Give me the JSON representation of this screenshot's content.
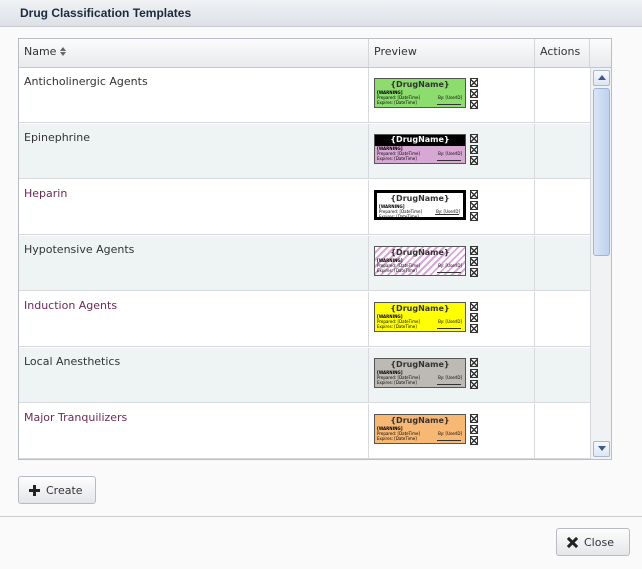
{
  "dialog": {
    "title": "Drug Classification Templates"
  },
  "grid": {
    "columns": {
      "name": "Name",
      "preview": "Preview",
      "actions": "Actions"
    },
    "rows": [
      {
        "name": "Anticholinergic Agents",
        "name_color": "#333333",
        "label_bg": "#8cdc6e",
        "label_pattern": "solid",
        "band": false,
        "border": "thin"
      },
      {
        "name": "Epinephrine",
        "name_color": "#333333",
        "label_bg": "#d8a8d4",
        "label_pattern": "solid",
        "band": true,
        "border": "thin"
      },
      {
        "name": "Heparin",
        "name_color": "#6b2a5a",
        "label_bg": "#ffffff",
        "label_pattern": "solid",
        "band": false,
        "border": "thick"
      },
      {
        "name": "Hypotensive Agents",
        "name_color": "#333333",
        "label_bg": "#ffffff",
        "label_pattern": "striped",
        "band": false,
        "border": "thin"
      },
      {
        "name": "Induction Agents",
        "name_color": "#6b2a5a",
        "label_bg": "#ffff00",
        "label_pattern": "solid",
        "band": false,
        "border": "thin"
      },
      {
        "name": "Local Anesthetics",
        "name_color": "#333333",
        "label_bg": "#bdbab3",
        "label_pattern": "solid",
        "band": false,
        "border": "thin"
      },
      {
        "name": "Major Tranquilizers",
        "name_color": "#6b2a5a",
        "label_bg": "#f7b873",
        "label_pattern": "solid",
        "band": false,
        "border": "thin"
      }
    ]
  },
  "label_template": {
    "drug_name": "{DrugName}",
    "warning": "[WARNING]",
    "prepared_by": "Prepared: [DateTime]",
    "expires": "Expires: [DateTime]",
    "user": "By: [UserID]"
  },
  "buttons": {
    "create": "Create",
    "close": "Close"
  },
  "icons": {
    "create": "plus-icon",
    "close": "x-icon",
    "sort": "sort-icon"
  }
}
